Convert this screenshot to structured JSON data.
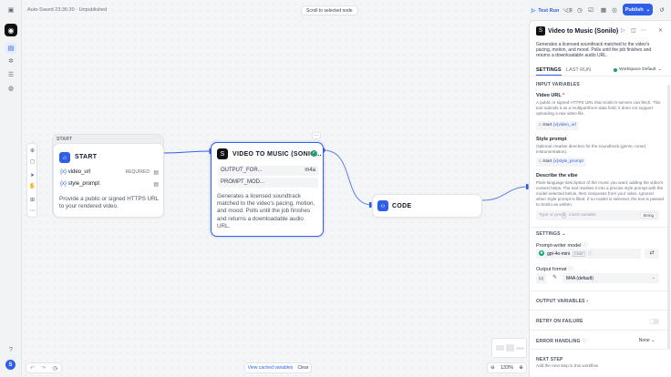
{
  "autosave": "Auto-Saved 23:36:30 · Unpublished",
  "scroll_to_selected": "Scroll to selected node",
  "toolbar": {
    "test_run": "Test Run",
    "test_run_shortcut": "⌥ R",
    "publish": "Publish"
  },
  "nodes": {
    "start": {
      "section": "START",
      "title": "START",
      "vars": [
        {
          "name": "video_url",
          "badge": "REQUIRED"
        },
        {
          "name": "style_prompt",
          "badge": ""
        }
      ],
      "description": "Provide a public or signed HTTPS URL to your rendered video."
    },
    "v2m": {
      "title": "VIDEO TO MUSIC (SONIO...",
      "params": [
        {
          "label": "OUTPUT_FOR...",
          "value": "m4a"
        },
        {
          "label": "PROMPT_MOD...",
          "value": ""
        }
      ],
      "description": "Generates a licensed soundtrack matched to the video's pacing, motion, and mood. Polls until the job finishes and returns a downloadable audio URL."
    },
    "code": {
      "title": "CODE"
    }
  },
  "bottom": {
    "view_cached": "View cached variables",
    "clear": "Clear",
    "zoom": "133%"
  },
  "panel": {
    "title": "Video to Music (Sonilo)",
    "description": "Generates a licensed soundtrack matched to the video's pacing, motion, and mood. Polls until the job finishes and returns a downloadable audio URL.",
    "tabs": [
      "SETTINGS",
      "LAST RUN"
    ],
    "workspace": "Workspace Default",
    "input_vars_header": "INPUT VARIABLES",
    "video_url": {
      "label": "Video URL",
      "required": "*",
      "help": "A public or signed HTTPS URL that Sonilo's servers can fetch. This tool submits it as a multipart/form-data field; it does not support uploading a raw video file.",
      "chip_prefix": "Start",
      "chip_var": "{x}video_url"
    },
    "style_prompt": {
      "label": "Style prompt",
      "help": "Optional creative direction for the soundtrack (genre, mood, instrumentation).",
      "chip_prefix": "Start",
      "chip_var": "{x}style_prompt"
    },
    "describe_vibe": {
      "label": "Describe the vibe",
      "help": "Plain-language description of the music you want; adding the video's context helps. The tool rewrites it into a precise style prompt with the model selected below, then composes from your video. Ignored when Style prompt is filled. If no model is selected, the text is passed to Sonilo as written.",
      "placeholder": "Type or press",
      "insert": "insert variable",
      "type": "String"
    },
    "settings_header": "SETTINGS",
    "prompt_writer_label": "Prompt-writer model",
    "prompt_writer_model": "gpt-4o-mini",
    "prompt_writer_tag": "CHAT",
    "output_format_label": "Output format",
    "output_format_value": "M4A (default)",
    "output_vars": "OUTPUT VARIABLES",
    "retry": "RETRY ON FAILURE",
    "error_handling": "ERROR HANDLING",
    "error_handling_value": "None",
    "next_step_title": "NEXT STEP",
    "next_step_desc": "Add the next step in this workflow"
  }
}
